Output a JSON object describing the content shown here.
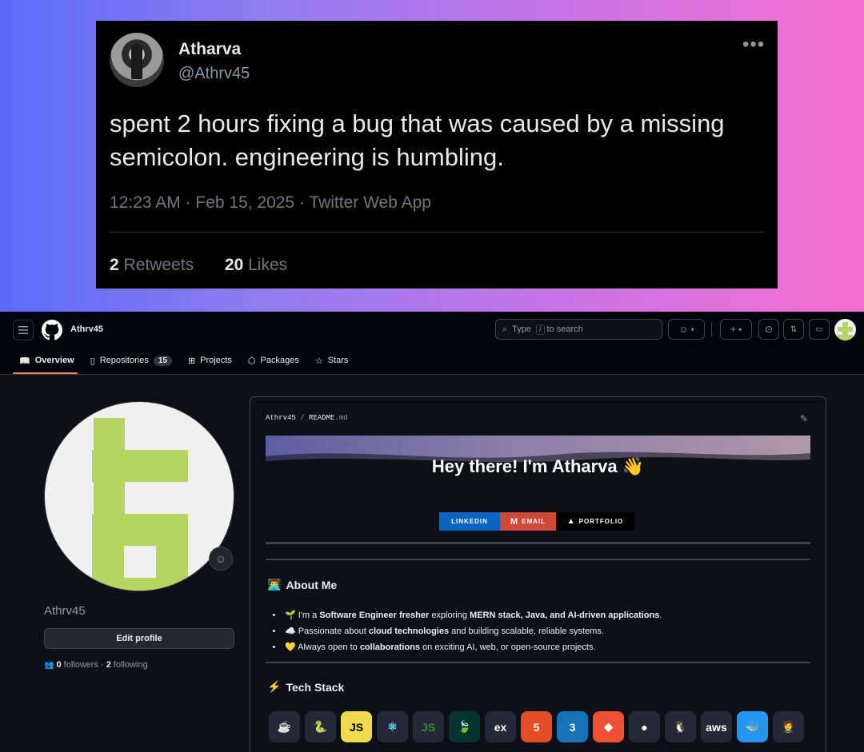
{
  "tweet": {
    "name": "Atharva",
    "handle": "@Athrv45",
    "more": "•••",
    "text": "spent 2 hours fixing a bug that was caused by a missing semicolon. engineering is humbling.",
    "meta": "12:23 AM · Feb 15, 2025 · Twitter Web App",
    "retweets_count": "2",
    "retweets_label": "Retweets",
    "likes_count": "20",
    "likes_label": "Likes"
  },
  "github": {
    "username": "Athrv45",
    "search": {
      "prefix": "Type",
      "key": "/",
      "suffix": "to search"
    },
    "tabs": [
      {
        "label": "Overview",
        "icon": "book-icon"
      },
      {
        "label": "Repositories",
        "icon": "repo-icon",
        "count": "15"
      },
      {
        "label": "Projects",
        "icon": "table-icon"
      },
      {
        "label": "Packages",
        "icon": "package-icon"
      },
      {
        "label": "Stars",
        "icon": "star-icon"
      }
    ],
    "profile": {
      "name": "Athrv45",
      "edit_label": "Edit profile",
      "followers_count": "0",
      "followers_label": "followers",
      "following_count": "2",
      "following_label": "following",
      "separator": "·"
    },
    "readme": {
      "path_user": "Athrv45",
      "path_sep": "/",
      "path_file": "README",
      "path_ext": ".md",
      "greeting": "Hey there! I'm Atharva 👋",
      "badges": [
        "LINKEDIN",
        "EMAIL",
        "PORTFOLIO"
      ],
      "about_heading": "About Me",
      "about_emoji": "👨‍💻",
      "about_items": [
        {
          "emoji": "🌱",
          "a": "I'm a ",
          "b": "Software Engineer fresher",
          "c": " exploring ",
          "d": "MERN stack, Java, and AI-driven applications",
          "e": "."
        },
        {
          "emoji": "☁️",
          "a": "Passionate about ",
          "b": "cloud technologies",
          "c": " and building scalable, reliable systems.",
          "d": "",
          "e": ""
        },
        {
          "emoji": "💛",
          "a": "Always open to ",
          "b": "collaborations",
          "c": " on exciting AI, web, or open-source projects.",
          "d": "",
          "e": ""
        }
      ],
      "tech_heading": "Tech Stack",
      "tech_emoji": "⚡",
      "tech_icons": [
        {
          "name": "java-icon",
          "glyph": "☕",
          "color": "#e76f00"
        },
        {
          "name": "python-icon",
          "glyph": "🐍",
          "color": "#3776ab"
        },
        {
          "name": "javascript-icon",
          "glyph": "JS",
          "color": "#000000"
        },
        {
          "name": "react-icon",
          "glyph": "⚛",
          "color": "#61dafb"
        },
        {
          "name": "nodejs-icon",
          "glyph": "JS",
          "color": "#3c873a"
        },
        {
          "name": "mongodb-icon",
          "glyph": "🍃",
          "color": "#47a248"
        },
        {
          "name": "express-icon",
          "glyph": "ex",
          "color": "#ffffff"
        },
        {
          "name": "html5-icon",
          "glyph": "5",
          "color": "#ffffff"
        },
        {
          "name": "css3-icon",
          "glyph": "3",
          "color": "#ffffff"
        },
        {
          "name": "git-icon",
          "glyph": "◆",
          "color": "#ffffff"
        },
        {
          "name": "github-icon",
          "glyph": "●",
          "color": "#ffffff"
        },
        {
          "name": "linux-icon",
          "glyph": "🐧",
          "color": "#ffffff"
        },
        {
          "name": "aws-icon",
          "glyph": "aws",
          "color": "#ffffff"
        },
        {
          "name": "docker-icon",
          "glyph": "🐳",
          "color": "#ffffff"
        },
        {
          "name": "jenkins-icon",
          "glyph": "🤵",
          "color": "#d33833"
        }
      ]
    }
  }
}
